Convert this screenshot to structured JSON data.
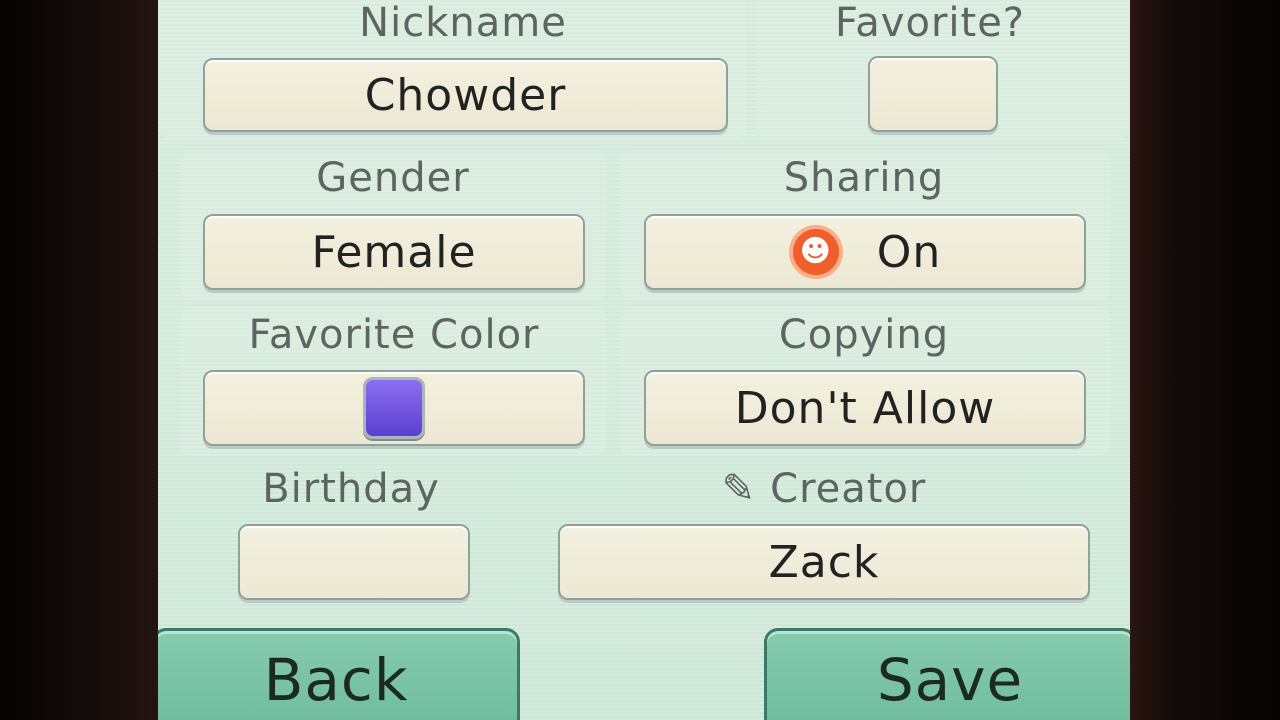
{
  "fields": {
    "nickname": {
      "label": "Nickname",
      "value": "Chowder"
    },
    "favorite": {
      "label": "Favorite?",
      "value": ""
    },
    "gender": {
      "label": "Gender",
      "value": "Female"
    },
    "sharing": {
      "label": "Sharing",
      "value": "On",
      "icon": "smiley-icon"
    },
    "favorite_color": {
      "label": "Favorite Color",
      "value_color": "#6a4fe0"
    },
    "copying": {
      "label": "Copying",
      "value": "Don't Allow"
    },
    "birthday": {
      "label": "Birthday",
      "value": ""
    },
    "creator": {
      "label": "Creator",
      "value": "Zack",
      "icon": "pencil-icon"
    }
  },
  "buttons": {
    "back": "Back",
    "save": "Save"
  },
  "colors": {
    "screen_bg": "#d6ecde",
    "button_bg": "#7cc4a8",
    "field_bg": "#f1eed9",
    "sharing_icon": "#ee5f2c"
  }
}
